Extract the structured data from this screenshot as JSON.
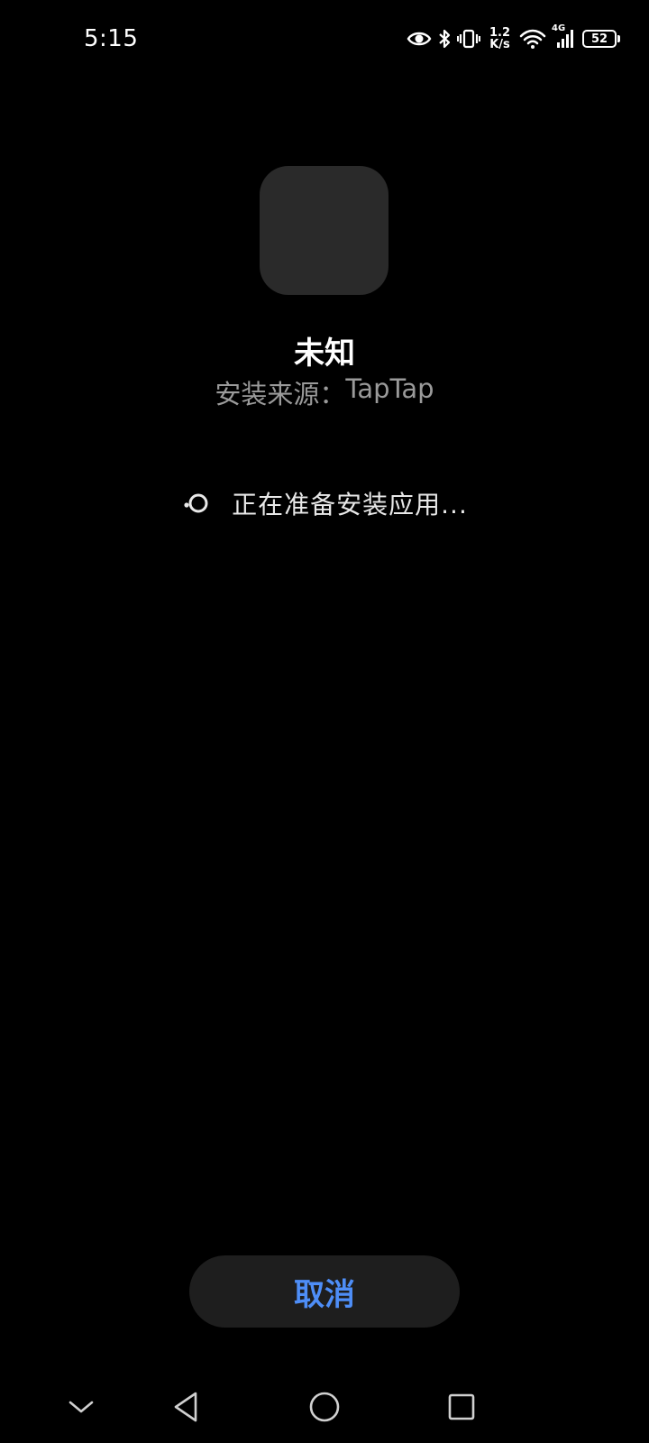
{
  "status_bar": {
    "time": "5:15",
    "net_speed_value": "1.2",
    "net_speed_unit": "K/s",
    "network_type": "4G",
    "battery_level": "52",
    "battery_fraction": 0.52,
    "icons": [
      "eye-icon",
      "bluetooth-icon",
      "vibrate-icon",
      "wifi-icon",
      "cellular-signal-icon",
      "battery-icon"
    ]
  },
  "app": {
    "name": "未知",
    "source_label": "安装来源：",
    "source_value": "TapTap"
  },
  "progress": {
    "text": "正在准备安装应用..."
  },
  "actions": {
    "cancel_label": "取消"
  },
  "colors": {
    "background": "#000000",
    "icon_placeholder": "#2a2a2a",
    "button_bg": "#1e1e1e",
    "accent": "#4e8ef7",
    "secondary_text": "#9a9a9a"
  },
  "nav_bar": {
    "buttons": [
      "hide-keyboard-icon",
      "back-icon",
      "home-icon",
      "recents-icon"
    ]
  }
}
